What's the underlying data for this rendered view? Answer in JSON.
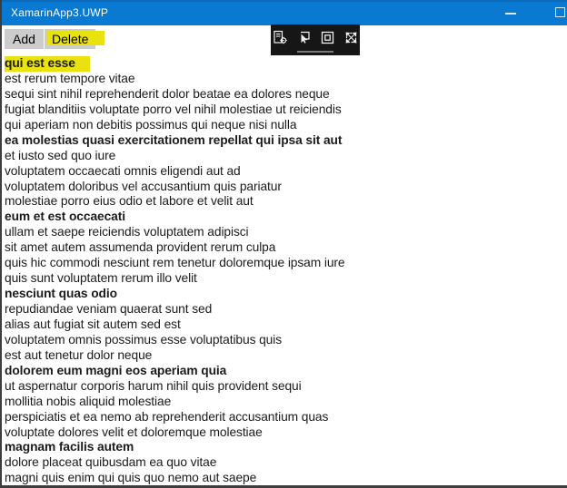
{
  "window": {
    "title": "XamarinApp3.UWP"
  },
  "action_bar": {
    "add_label": "Add",
    "delete_label": "Delete"
  },
  "debug_toolbar": {
    "icons": [
      "go-to-live-visual-tree-icon",
      "enable-selection-icon",
      "display-layout-adornments-icon",
      "track-focused-element-icon"
    ]
  },
  "colors": {
    "titlebar_accent": "#0a79d2",
    "button_background": "#cccccc",
    "annotation_highlight": "#e9e20e",
    "debug_toolbar_background": "#161616",
    "list_text": "#1b1b1b"
  },
  "list": {
    "items": [
      {
        "text": "qui est esse",
        "bold": true,
        "highlighted": true
      },
      {
        "text": "est rerum tempore vitae",
        "bold": false,
        "highlighted": false
      },
      {
        "text": "sequi sint nihil reprehenderit dolor beatae ea dolores neque",
        "bold": false,
        "highlighted": false
      },
      {
        "text": "fugiat blanditiis voluptate porro vel nihil molestiae ut reiciendis",
        "bold": false,
        "highlighted": false
      },
      {
        "text": "qui aperiam non debitis possimus qui neque nisi nulla",
        "bold": false,
        "highlighted": false
      },
      {
        "text": "ea molestias quasi exercitationem repellat qui ipsa sit aut",
        "bold": true,
        "highlighted": false
      },
      {
        "text": "et iusto sed quo iure",
        "bold": false,
        "highlighted": false
      },
      {
        "text": "voluptatem occaecati omnis eligendi aut ad",
        "bold": false,
        "highlighted": false
      },
      {
        "text": "voluptatem doloribus vel accusantium quis pariatur",
        "bold": false,
        "highlighted": false
      },
      {
        "text": "molestiae porro eius odio et labore et velit aut",
        "bold": false,
        "highlighted": false
      },
      {
        "text": "eum et est occaecati",
        "bold": true,
        "highlighted": false
      },
      {
        "text": "ullam et saepe reiciendis voluptatem adipisci",
        "bold": false,
        "highlighted": false
      },
      {
        "text": "sit amet autem assumenda provident rerum culpa",
        "bold": false,
        "highlighted": false
      },
      {
        "text": "quis hic commodi nesciunt rem tenetur doloremque ipsam iure",
        "bold": false,
        "highlighted": false
      },
      {
        "text": "quis sunt voluptatem rerum illo velit",
        "bold": false,
        "highlighted": false
      },
      {
        "text": "nesciunt quas odio",
        "bold": true,
        "highlighted": false
      },
      {
        "text": "repudiandae veniam quaerat sunt sed",
        "bold": false,
        "highlighted": false
      },
      {
        "text": "alias aut fugiat sit autem sed est",
        "bold": false,
        "highlighted": false
      },
      {
        "text": "voluptatem omnis possimus esse voluptatibus quis",
        "bold": false,
        "highlighted": false
      },
      {
        "text": "est aut tenetur dolor neque",
        "bold": false,
        "highlighted": false
      },
      {
        "text": "dolorem eum magni eos aperiam quia",
        "bold": true,
        "highlighted": false
      },
      {
        "text": "ut aspernatur corporis harum nihil quis provident sequi",
        "bold": false,
        "highlighted": false
      },
      {
        "text": "mollitia nobis aliquid molestiae",
        "bold": false,
        "highlighted": false
      },
      {
        "text": "perspiciatis et ea nemo ab reprehenderit accusantium quas",
        "bold": false,
        "highlighted": false
      },
      {
        "text": "voluptate dolores velit et doloremque molestiae",
        "bold": false,
        "highlighted": false
      },
      {
        "text": "magnam facilis autem",
        "bold": true,
        "highlighted": false
      },
      {
        "text": "dolore placeat quibusdam ea quo vitae",
        "bold": false,
        "highlighted": false
      },
      {
        "text": "magni quis enim qui quis quo nemo aut saepe",
        "bold": false,
        "highlighted": false
      }
    ]
  }
}
